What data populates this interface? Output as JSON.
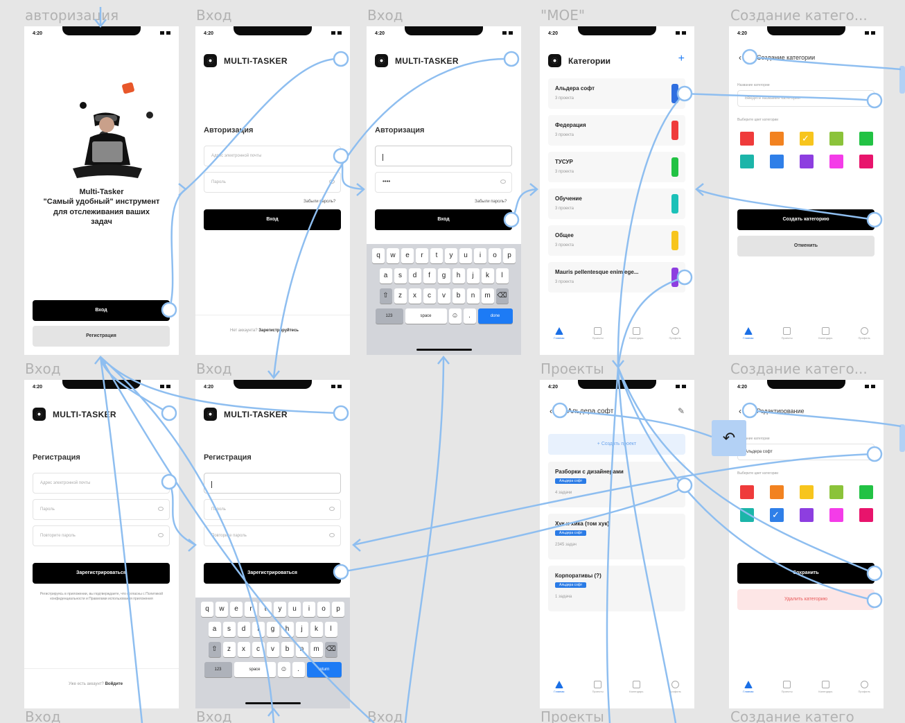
{
  "frames": {
    "f1": {
      "label": "авторизация"
    },
    "f2": {
      "label": "Вход"
    },
    "f3": {
      "label": "Вход"
    },
    "f4": {
      "label": "\"МОЕ\""
    },
    "f5": {
      "label": "Создание катего..."
    },
    "f6": {
      "label": "Вход"
    },
    "f7": {
      "label": "Вход"
    },
    "f8": {
      "label": "Проекты"
    },
    "f9": {
      "label": "Создание катего..."
    },
    "b1": {
      "label": "Вход"
    },
    "b2": {
      "label": "Вход"
    },
    "b3": {
      "label": "Вход"
    },
    "b4": {
      "label": "Проекты"
    },
    "b5": {
      "label": "Создание катего"
    }
  },
  "status": {
    "time": "4:20",
    "time_alt": "4:20"
  },
  "brand": {
    "name": "MULTI-TASKER"
  },
  "welcome": {
    "line1": "Multi-Tasker",
    "line2": "\"Самый удобный\" инструмент",
    "line3": "для отслеживания ваших",
    "line4": "задач",
    "login_button": "Вход",
    "register_button": "Регистрация"
  },
  "login": {
    "title": "Авторизация",
    "email_placeholder": "Адрес электронной почты",
    "password_placeholder": "Пароль",
    "password_value": "••••",
    "forgot": "Забыли пароль?",
    "submit": "Вход",
    "no_account": "Нет аккаунта?",
    "register_link": "Зарегистрируйтесь"
  },
  "register": {
    "title": "Регистрация",
    "email_placeholder": "Адрес электронной почты",
    "password_placeholder": "Пароль",
    "repeat_placeholder": "Повторите пароль",
    "submit": "Зарегистрироваться",
    "terms": "Регистрируясь в приложении, вы подтверждаете, что согласны с Политикой конфиденциальности и Правилами использования приложения",
    "have_account": "Уже есть аккаунт?",
    "login_link": "Войдите"
  },
  "keyboard": {
    "row1": [
      "q",
      "w",
      "e",
      "r",
      "t",
      "y",
      "u",
      "i",
      "o",
      "p"
    ],
    "row2": [
      "a",
      "s",
      "d",
      "f",
      "g",
      "h",
      "j",
      "k",
      "l"
    ],
    "row3": [
      "z",
      "x",
      "c",
      "v",
      "b",
      "n",
      "m"
    ],
    "num": "123",
    "space": "space",
    "go_login": "done",
    "go_register": "return"
  },
  "categories": {
    "title": "Категории",
    "items": [
      {
        "name": "Альдера софт",
        "count": "3 проекта",
        "color": "#2f6fe0"
      },
      {
        "name": "Федерация",
        "count": "3 проекта",
        "color": "#ef3b3b"
      },
      {
        "name": "ТУСУР",
        "count": "3 проекта",
        "color": "#22c244"
      },
      {
        "name": "Обучение",
        "count": "3 проекта",
        "color": "#1cc1b8"
      },
      {
        "name": "Общее",
        "count": "3 проекта",
        "color": "#f7c51d"
      },
      {
        "name": "Mauris pellentesque enim ege...",
        "count": "3 проекта",
        "color": "#8d3ee0"
      }
    ]
  },
  "tabs": {
    "home": "Главная",
    "projects": "Проекты",
    "calendar": "Календарь",
    "profile": "Профиль"
  },
  "create_category": {
    "title": "Создание категории",
    "name_label": "Название категории",
    "name_placeholder": "Введите название категории",
    "color_label": "Выберите цвет категории",
    "create_button": "Создать категорию",
    "cancel_button": "Отменить"
  },
  "edit_category": {
    "title": "Редактирование",
    "name_label": "Название категории",
    "name_value": "Альдера софт",
    "color_label": "Выберите цвет категории",
    "save_button": "Сохранить",
    "delete_button": "Удалить категорию"
  },
  "colors": [
    "#ef3b3b",
    "#f28220",
    "#f7c51d",
    "#8bc33a",
    "#22c244",
    "#1cb5a9",
    "#2f7fe8",
    "#8d3ee0",
    "#f43ce8",
    "#e8146c"
  ],
  "projects": {
    "title": "Альдера софт",
    "add_task": "+ Создать проект",
    "items": [
      {
        "name": "Разборки с дизайнерами",
        "badge": "Альдера софт",
        "count": "4 задачи"
      },
      {
        "name": "Хук и хика (том хук)",
        "badge": "Альдера софт",
        "count": "2345 задач"
      },
      {
        "name": "Корпоративы (?)",
        "badge": "Альдера софт",
        "count": "1 задача"
      }
    ]
  },
  "back_icon": "reply-arrow",
  "accent": "#1d7bf5",
  "wire_color": "#8ebef0"
}
